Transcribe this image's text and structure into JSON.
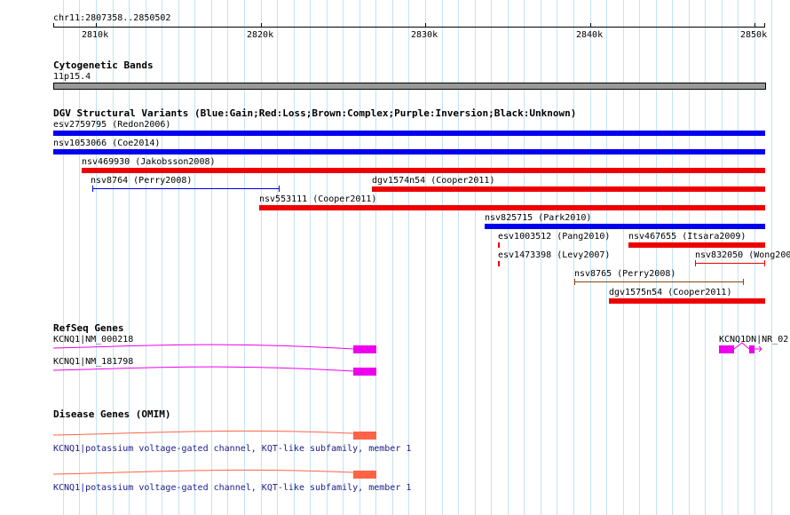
{
  "ruler": {
    "region": "chr11:2807358..2850502",
    "ticks": [
      {
        "label": "2810k",
        "kb": 2810
      },
      {
        "label": "2820k",
        "kb": 2820
      },
      {
        "label": "2830k",
        "kb": 2830
      },
      {
        "label": "2840k",
        "kb": 2840
      },
      {
        "label": "2850k",
        "kb": 2850
      }
    ]
  },
  "cytoband": {
    "title": "Cytogenetic Bands",
    "band": "11p15.4",
    "band_color": "#999999"
  },
  "dgv": {
    "title": "DGV Structural Variants (Blue:Gain;Red:Loss;Brown:Complex;Purple:Inversion;Black:Unknown)",
    "colors": {
      "gain": "#0000ee",
      "loss": "#ee0000",
      "complex": "#8b4513"
    },
    "variants": [
      {
        "label": "esv2759795 (Redon2006)",
        "type": "gain"
      },
      {
        "label": "nsv1053066 (Coe2014)",
        "type": "gain"
      },
      {
        "label": "nsv469930 (Jakobsson2008)",
        "type": "loss"
      },
      {
        "label": "nsv8764 (Perry2008)",
        "type": "gain"
      },
      {
        "label": "dgv1574n54 (Cooper2011)",
        "type": "loss"
      },
      {
        "label": "nsv553111 (Cooper2011)",
        "type": "loss"
      },
      {
        "label": "nsv825715 (Park2010)",
        "type": "gain"
      },
      {
        "label": "esv1003512 (Pang2010)",
        "type": "loss"
      },
      {
        "label": "nsv467655 (Itsara2009)",
        "type": "loss"
      },
      {
        "label": "esv1473398 (Levy2007)",
        "type": "loss"
      },
      {
        "label": "nsv832050 (Wong200",
        "type": "loss"
      },
      {
        "label": "nsv8765 (Perry2008)",
        "type": "complex"
      },
      {
        "label": "dgv1575n54 (Cooper2011)",
        "type": "loss"
      }
    ]
  },
  "refseq": {
    "title": "RefSeq Genes",
    "color": "#ee00ee",
    "genes": [
      {
        "label": "KCNQ1|NM_000218"
      },
      {
        "label": "KCNQ1|NM_181798"
      },
      {
        "label": "KCNQ1DN|NR_02"
      }
    ]
  },
  "omim": {
    "title": "Disease Genes (OMIM)",
    "color": "#ff6347",
    "genes": [
      {
        "label": "KCNQ1|potassium voltage-gated channel, KQT-like subfamily, member 1"
      },
      {
        "label": "KCNQ1|potassium voltage-gated channel, KQT-like subfamily, member 1"
      }
    ]
  }
}
